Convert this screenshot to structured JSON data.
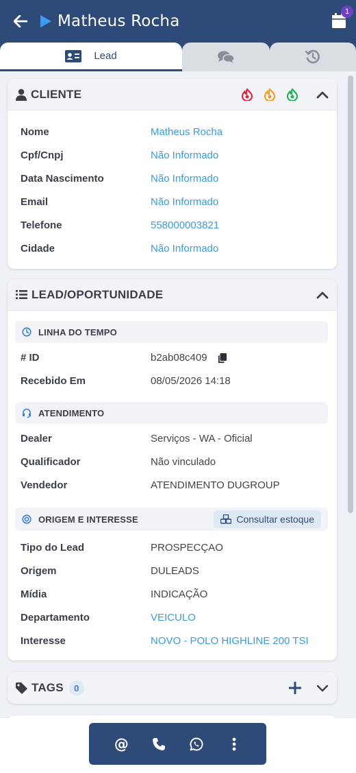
{
  "header": {
    "title": "Matheus Rocha",
    "calendar_badge": "1"
  },
  "tabs": [
    {
      "label": "Lead"
    }
  ],
  "cliente": {
    "title": "CLIENTE",
    "rows": [
      {
        "label": "Nome",
        "value": "Matheus Rocha"
      },
      {
        "label": "Cpf/Cnpj",
        "value": "Não Informado"
      },
      {
        "label": "Data Nascimento",
        "value": "Não Informado"
      },
      {
        "label": "Email",
        "value": "Não Informado"
      },
      {
        "label": "Telefone",
        "value": "558000003821"
      },
      {
        "label": "Cidade",
        "value": "Não Informado"
      }
    ],
    "temperature_colors": [
      "#e0263f",
      "#f0a020",
      "#1fb05a"
    ]
  },
  "lead": {
    "title": "LEAD/OPORTUNIDADE",
    "timeline": {
      "title": "LINHA DO TEMPO",
      "rows": [
        {
          "label": "# ID",
          "value": "b2ab08c409"
        },
        {
          "label": "Recebido Em",
          "value": "08/05/2026 14:18"
        }
      ]
    },
    "atendimento": {
      "title": "ATENDIMENTO",
      "rows": [
        {
          "label": "Dealer",
          "value": "Serviços - WA - Oficial"
        },
        {
          "label": "Qualificador",
          "value": "Não vinculado"
        },
        {
          "label": "Vendedor",
          "value": "ATENDIMENTO DUGROUP"
        }
      ]
    },
    "origem": {
      "title": "ORIGEM E INTERESSE",
      "stock_button": "Consultar estoque",
      "rows": [
        {
          "label": "Tipo do Lead",
          "value": "PROSPECÇAO"
        },
        {
          "label": "Origem",
          "value": "DULEADS"
        },
        {
          "label": "Mídia",
          "value": "INDICAÇÃO"
        },
        {
          "label": "Departamento",
          "value": "VEICULO"
        },
        {
          "label": "Interesse",
          "value": "NOVO - POLO HIGHLINE 200 TSI"
        }
      ]
    }
  },
  "tags": {
    "title": "TAGS",
    "count": "0"
  },
  "bottom_bar": {
    "mention_label": "@"
  },
  "colors": {
    "primary": "#2e4a78",
    "link": "#3b9bd8",
    "accent_badge": "#6f42c1"
  }
}
